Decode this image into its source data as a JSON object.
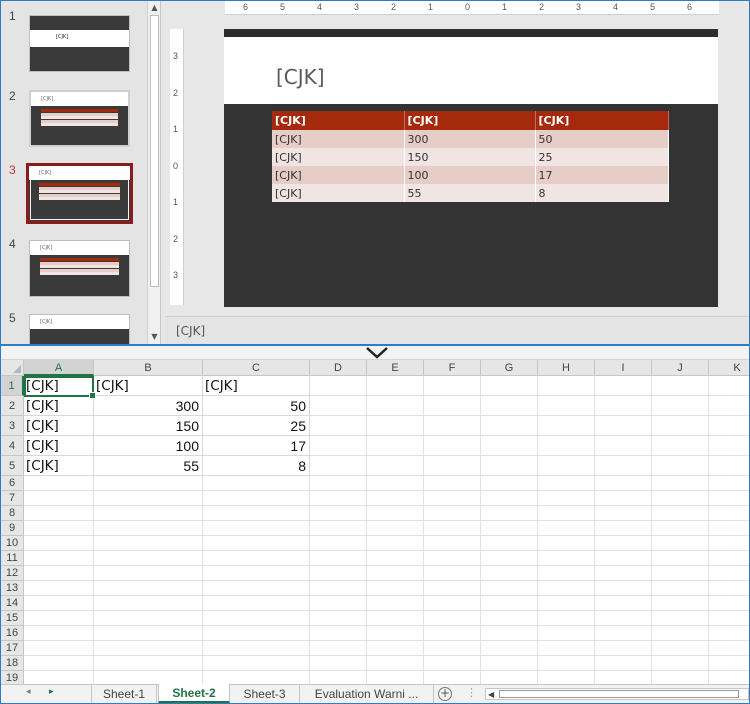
{
  "ppt": {
    "thumbnails": [
      {
        "num": "1",
        "title": "[CJK]"
      },
      {
        "num": "2",
        "title": "[CJK]"
      },
      {
        "num": "3",
        "title": "[CJK]"
      },
      {
        "num": "4",
        "title": "[CJK]"
      },
      {
        "num": "5",
        "title": "[CJK]"
      }
    ],
    "hruler": [
      "6",
      "5",
      "4",
      "3",
      "2",
      "1",
      "0",
      "1",
      "2",
      "3",
      "4",
      "5",
      "6"
    ],
    "vruler": [
      "3",
      "2",
      "1",
      "0",
      "1",
      "2",
      "3"
    ],
    "slide": {
      "title": "[CJK]",
      "table": {
        "headers": [
          "[CJK]",
          "[CJK]",
          "[CJK]"
        ],
        "rows": [
          [
            "[CJK]",
            "300",
            "50"
          ],
          [
            "[CJK]",
            "150",
            "25"
          ],
          [
            "[CJK]",
            "100",
            "17"
          ],
          [
            "[CJK]",
            "55",
            "8"
          ]
        ]
      }
    },
    "notes_placeholder": "[CJK]"
  },
  "excel": {
    "columns": [
      "A",
      "B",
      "C",
      "D",
      "E",
      "F",
      "G",
      "H",
      "I",
      "J",
      "K"
    ],
    "rows": [
      "1",
      "2",
      "3",
      "4",
      "5",
      "6",
      "7",
      "8",
      "9",
      "10",
      "11",
      "12",
      "13",
      "14",
      "15",
      "16",
      "17",
      "18",
      "19"
    ],
    "cells": {
      "header": [
        "[CJK]",
        "[CJK]",
        "[CJK]"
      ],
      "data": [
        [
          "[CJK]",
          "300",
          "50"
        ],
        [
          "[CJK]",
          "150",
          "25"
        ],
        [
          "[CJK]",
          "100",
          "17"
        ],
        [
          "[CJK]",
          "55",
          "8"
        ]
      ]
    },
    "selected_cell": "A1",
    "sheet_tabs": [
      "Sheet-1",
      "Sheet-2",
      "Sheet-3",
      "Evaluation Warni ..."
    ],
    "active_sheet": "Sheet-2",
    "add_sheet_label": "+"
  },
  "colors": {
    "accent_excel": "#217346",
    "slide_bg": "#333333",
    "table_header": "#a52a0d",
    "selected_thumb_border": "#8b1c1c"
  }
}
